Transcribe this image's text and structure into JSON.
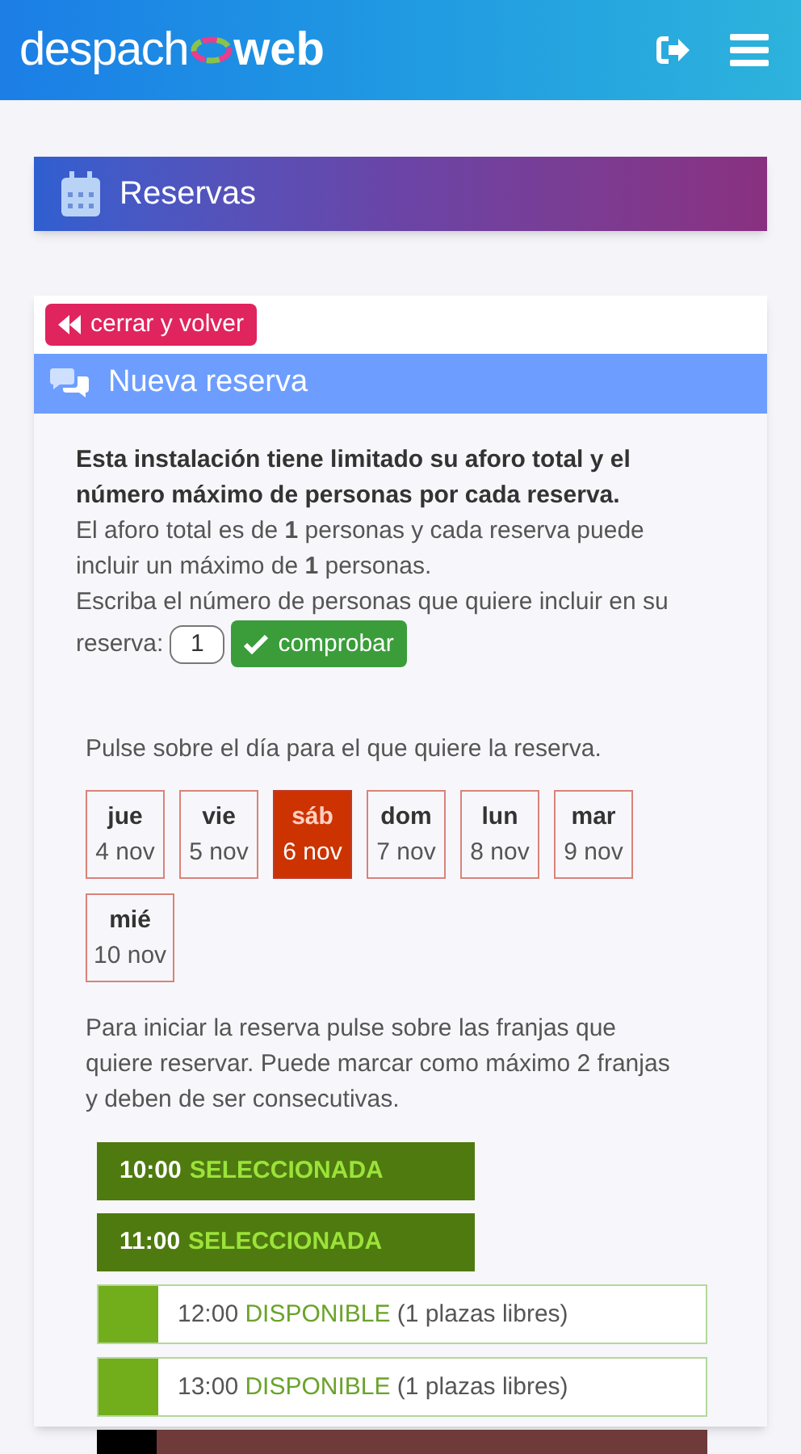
{
  "header": {
    "logo_left": "despach",
    "logo_right": "web"
  },
  "page_title": "Reservas",
  "close_button": "cerrar y volver",
  "panel_title": "Nueva reserva",
  "intro": "Esta instalación tiene limitado su aforo total y el número máximo de personas por cada reserva.",
  "capacity_text": "El aforo total es de **1** personas y cada reserva puede incluir un máximo de **1** personas.",
  "people_prompt": [
    "Escriba el número de personas que quiere incluir en su",
    "reserva:"
  ],
  "people_value": "1",
  "check_button": "comprobar",
  "day_prompt": "Pulse sobre el día para el que quiere la reserva.",
  "days": [
    {
      "weekday": "jue",
      "date": "4 nov",
      "selected": false
    },
    {
      "weekday": "vie",
      "date": "5 nov",
      "selected": false
    },
    {
      "weekday": "sáb",
      "date": "6 nov",
      "selected": true
    },
    {
      "weekday": "dom",
      "date": "7 nov",
      "selected": false
    },
    {
      "weekday": "lun",
      "date": "8 nov",
      "selected": false
    },
    {
      "weekday": "mar",
      "date": "9 nov",
      "selected": false
    },
    {
      "weekday": "mié",
      "date": "10 nov",
      "selected": false
    }
  ],
  "slots_prompt": "Para iniciar la reserva pulse sobre las franjas que quiere reservar. Puede marcar como máximo 2 franjas y deben de ser consecutivas.",
  "slots": [
    {
      "kind": "selected",
      "time": "10:00",
      "status": "SELECCIONADA"
    },
    {
      "kind": "selected",
      "time": "11:00",
      "status": "SELECCIONADA"
    },
    {
      "kind": "available",
      "time": "12:00",
      "status": "DISPONIBLE",
      "note": "(1 plazas libres)"
    },
    {
      "kind": "available",
      "time": "13:00",
      "status": "DISPONIBLE",
      "note": "(1 plazas libres)"
    },
    {
      "kind": "closed"
    }
  ]
}
